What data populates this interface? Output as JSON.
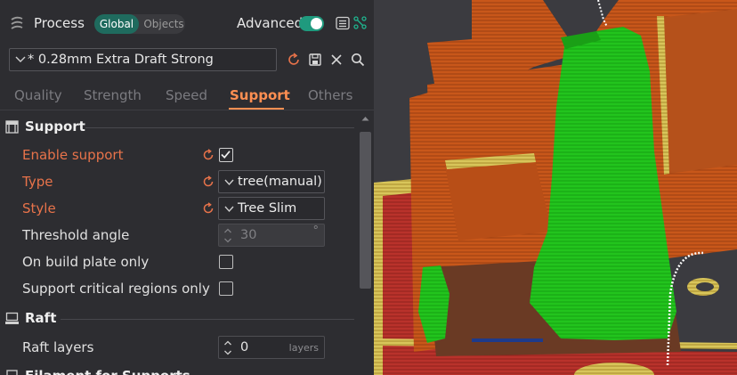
{
  "header": {
    "title": "Process",
    "mode_global": "Global",
    "mode_objects": "Objects",
    "advanced_label": "Advanced",
    "advanced_on": true
  },
  "preset": {
    "name": "* 0.28mm Extra Draft Strong"
  },
  "tabs": [
    {
      "label": "Quality",
      "active": false
    },
    {
      "label": "Strength",
      "active": false
    },
    {
      "label": "Speed",
      "active": false
    },
    {
      "label": "Support",
      "active": true
    },
    {
      "label": "Others",
      "active": false
    }
  ],
  "support_section": {
    "title": "Support",
    "rows": [
      {
        "label": "Enable support",
        "modified": true,
        "control": "checkbox",
        "checked": true
      },
      {
        "label": "Type",
        "modified": true,
        "control": "combo",
        "value": "tree(manual)"
      },
      {
        "label": "Style",
        "modified": true,
        "control": "combo",
        "value": "Tree Slim"
      },
      {
        "label": "Threshold angle",
        "modified": false,
        "control": "spin",
        "value": "30",
        "unit": "°",
        "disabled": true
      },
      {
        "label": "On build plate only",
        "modified": false,
        "control": "checkbox",
        "checked": false
      },
      {
        "label": "Support critical regions only",
        "modified": false,
        "control": "checkbox",
        "checked": false
      }
    ]
  },
  "raft_section": {
    "title": "Raft",
    "rows": [
      {
        "label": "Raft layers",
        "control": "spin",
        "value": "0",
        "unit": "layers"
      }
    ]
  },
  "next_section_title": "Filament for Supports",
  "colors": {
    "accent": "#ff8f52",
    "modified_label": "#e8734a",
    "toggle_on": "#1f9a7e",
    "support_green": "#22c41d",
    "model_orange": "#c8571a",
    "bed_red": "#b9322b",
    "panel_bg": "#2d2d31"
  }
}
